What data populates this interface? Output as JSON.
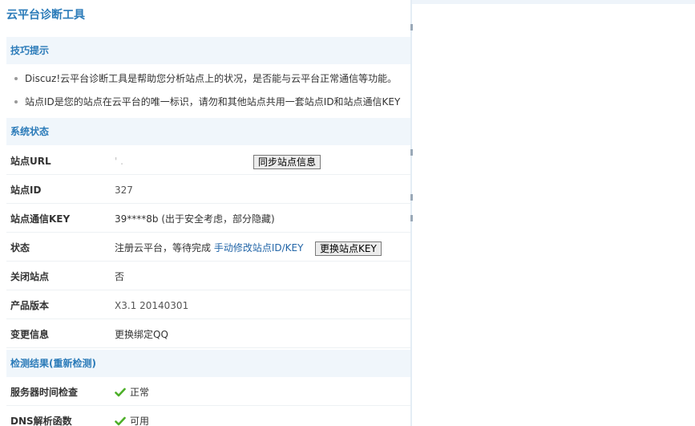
{
  "page": {
    "title": "云平台诊断工具"
  },
  "tips": {
    "header": "技巧提示",
    "items": [
      "Discuz!云平台诊断工具是帮助您分析站点上的状况，是否能与云平台正常通信等功能。",
      "站点ID是您的站点在云平台的唯一标识，请勿和其他站点共用一套站点ID和站点通信KEY"
    ]
  },
  "system": {
    "header": "系统状态",
    "rows": {
      "site_url": {
        "label": "站点URL",
        "value": "' .",
        "button": "同步站点信息"
      },
      "site_id": {
        "label": "站点ID",
        "value": "327"
      },
      "site_key": {
        "label": "站点通信KEY",
        "value": "39****8b (出于安全考虑，部分隐藏)"
      },
      "status": {
        "label": "状态",
        "value": "注册云平台，等待完成",
        "link": "手动修改站点ID/KEY",
        "button": "更换站点KEY"
      },
      "close_site": {
        "label": "关闭站点",
        "value": "否"
      },
      "version": {
        "label": "产品版本",
        "value": "X3.1 20140301"
      },
      "change_info": {
        "label": "变更信息",
        "link": "更换绑定QQ"
      }
    }
  },
  "detection": {
    "header": "检测结果(重新检测)",
    "rows": [
      {
        "label": "服务器时间检查",
        "result": "正常"
      },
      {
        "label": "DNS解析函数",
        "result": "可用"
      }
    ]
  },
  "colors": {
    "accent": "#2b7bb9",
    "link": "#2366a8",
    "check": "#4caf28",
    "section_bg": "#f0f6fb"
  }
}
